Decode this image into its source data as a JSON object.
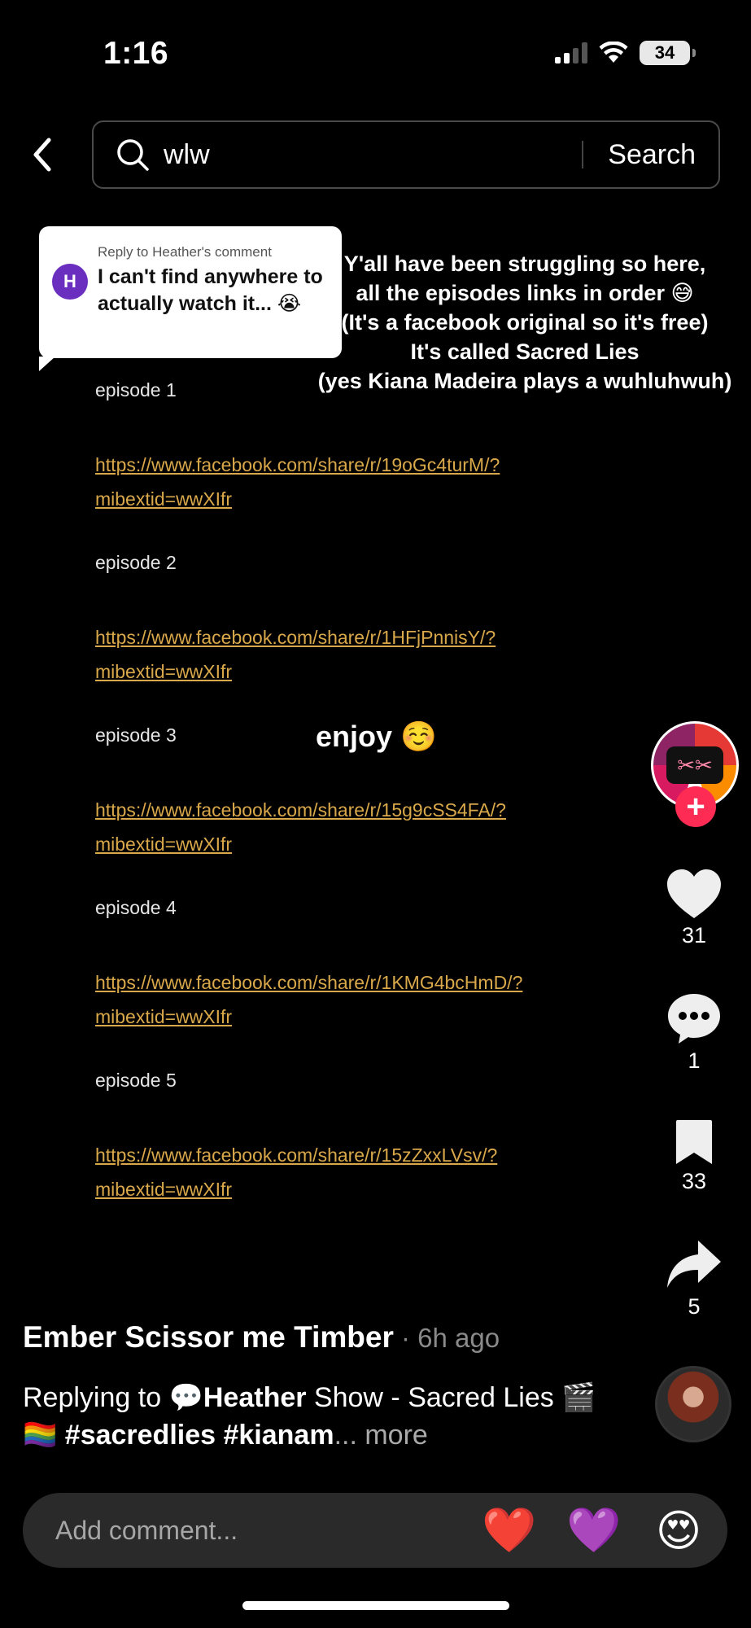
{
  "status_bar": {
    "time": "1:16",
    "battery": "34"
  },
  "search": {
    "query": "wlw",
    "button_label": "Search"
  },
  "reply_bubble": {
    "avatar_letter": "H",
    "meta": "Reply to Heather's comment",
    "text": "I can't find anywhere to actually watch it... 😭"
  },
  "overlay_caption": [
    "Y'all have been struggling so here,",
    "all the episodes links in order 😅",
    "(It's a facebook original so it's free)",
    "It's called Sacred Lies",
    "(yes Kiana Madeira plays a wuhluhwuh)"
  ],
  "episodes": [
    {
      "label": "episode 1",
      "link_line1": "https://www.facebook.com/share/r/19oGc4turM/?",
      "link_line2": "mibextid=wwXIfr"
    },
    {
      "label": "episode 2",
      "link_line1": "https://www.facebook.com/share/r/1HFjPnnisY/?",
      "link_line2": "mibextid=wwXIfr"
    },
    {
      "label": "episode 3",
      "link_line1": "https://www.facebook.com/share/r/15g9cSS4FA/?",
      "link_line2": "mibextid=wwXIfr"
    },
    {
      "label": "episode 4",
      "link_line1": "https://www.facebook.com/share/r/1KMG4bcHmD/?",
      "link_line2": "mibextid=wwXIfr"
    },
    {
      "label": "episode 5",
      "link_line1": "https://www.facebook.com/share/r/15zZxxLVsv/?",
      "link_line2": "mibextid=wwXIfr"
    }
  ],
  "enjoy_text": "enjoy ☺️",
  "actions": {
    "likes": "31",
    "comments": "1",
    "saves": "33",
    "shares": "5",
    "follow": "+"
  },
  "post": {
    "author": "Ember Scissor me Timber",
    "time": " · 6h ago",
    "replying_prefix": "Replying to ",
    "replying_user": "💬Heather",
    "desc_text": "  Show - Sacred Lies 🎬🏳️‍🌈 ",
    "hashtags": "#sacredlies #kianam",
    "more": "... more"
  },
  "comment_bar": {
    "placeholder": "Add comment...",
    "emojis": [
      "❤️",
      "💜",
      "😍"
    ]
  },
  "colors": {
    "link": "#d9a84a",
    "follow": "#fe2c55",
    "background": "#000000"
  }
}
